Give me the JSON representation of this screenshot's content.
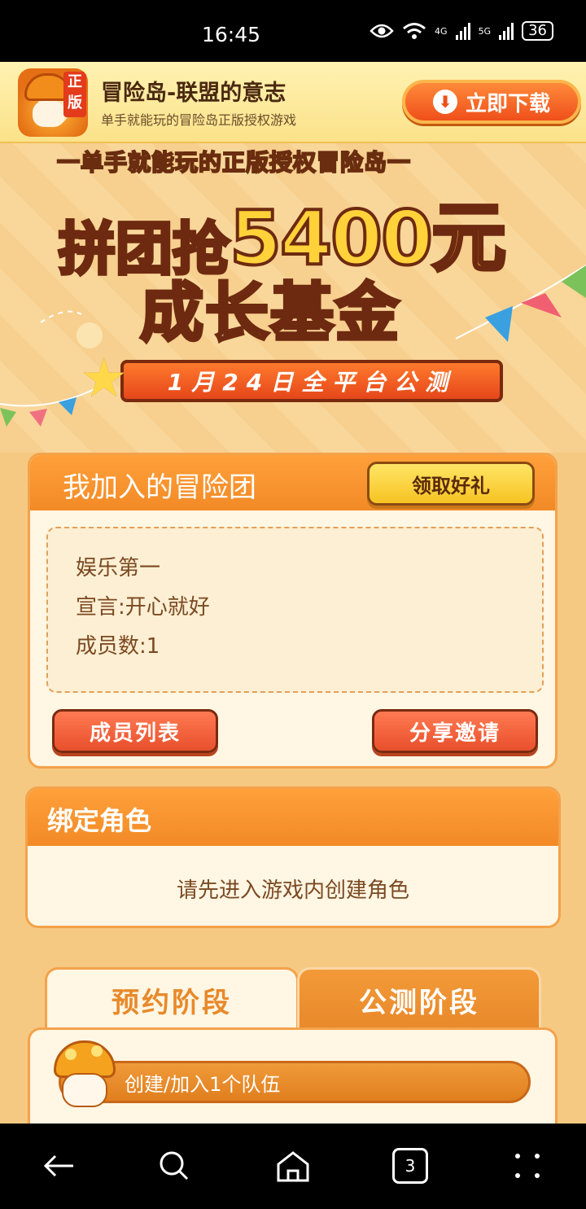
{
  "status_bar": {
    "time": "16:45",
    "network_1": "4G",
    "network_2": "5G",
    "battery": "36"
  },
  "download_banner": {
    "app_icon_tag": "正版",
    "title": "冒险岛-联盟的意志",
    "subtitle": "单手就能玩的冒险岛正版授权游戏",
    "button_label": "立即下载"
  },
  "hero": {
    "top_slogan": "一单手就能玩的正版授权冒险岛一",
    "line1_prefix": "拼团抢",
    "line1_amount": "5400元",
    "line2": "成长基金",
    "date_ribbon": "1月24日全平台公测"
  },
  "team_card": {
    "title": "我加入的冒险团",
    "gift_button": "领取好礼",
    "team_name": "娱乐第一",
    "declaration": "宣言:开心就好",
    "member_count": "成员数:1",
    "member_list_button": "成员列表",
    "share_button": "分享邀请"
  },
  "bind_card": {
    "title": "绑定角色",
    "message": "请先进入游戏内创建角色"
  },
  "phase_tabs": {
    "active_tab": "预约阶段",
    "inactive_tab": "公测阶段"
  },
  "tasks": [
    {
      "label": "创建/加入1个队伍"
    }
  ],
  "nav_bar": {
    "tabs_count": "3"
  },
  "colors": {
    "accent_orange": "#f28a26",
    "card_bg": "#fff6e3",
    "button_red": "#e8502c",
    "button_yellow": "#f6c322"
  }
}
